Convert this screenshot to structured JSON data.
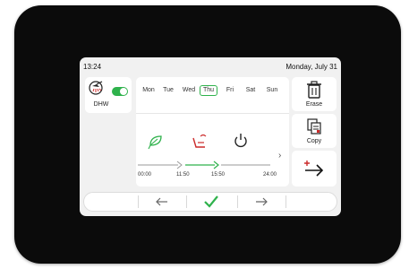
{
  "status": {
    "time": "13:24",
    "date": "Monday, July 31"
  },
  "dhw": {
    "label": "DHW",
    "enabled": true
  },
  "schedule": {
    "days": [
      "Mon",
      "Tue",
      "Wed",
      "Thu",
      "Fri",
      "Sat",
      "Sun"
    ],
    "selected_day": "Thu",
    "time_labels": [
      "00:00",
      "11:50",
      "15:50",
      "24:00"
    ],
    "segments": [
      {
        "icon": "eco-leaf-icon",
        "start": "00:00",
        "end": "11:50"
      },
      {
        "icon": "comfort-chair-icon",
        "start": "11:50",
        "end": "15:50"
      },
      {
        "icon": "power-off-icon",
        "start": "15:50",
        "end": "24:00"
      }
    ]
  },
  "actions": {
    "erase_label": "Erase",
    "copy_label": "Copy",
    "paste_icon": "paste-arrow-icon"
  },
  "colors": {
    "accent_green": "#2fb24c",
    "accent_red": "#cc2a2a",
    "device_bezel": "#0b0b0b",
    "screen_bg": "#f1f1f1"
  }
}
